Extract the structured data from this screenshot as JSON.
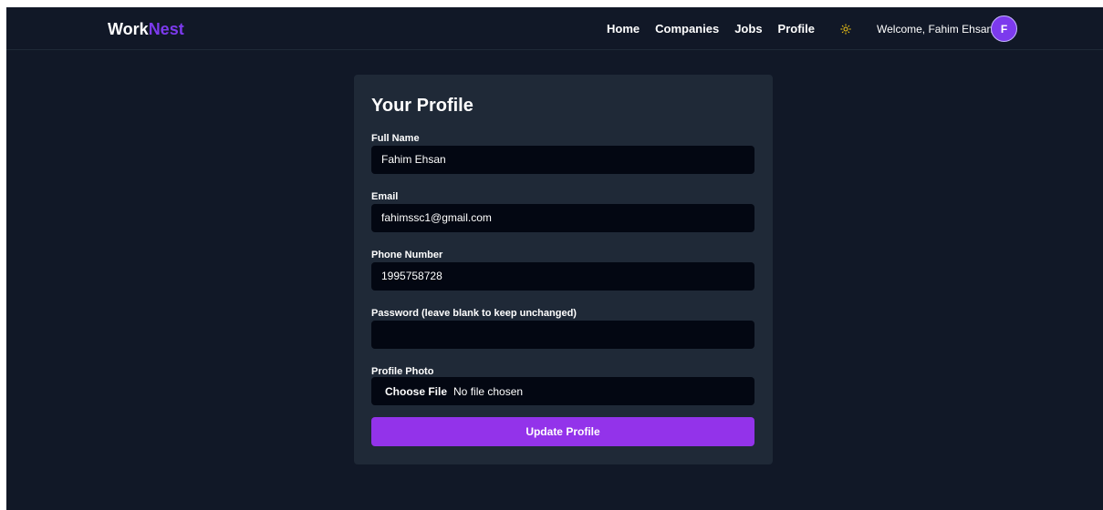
{
  "navbar": {
    "logo_part1": "Work",
    "logo_part2": "Nest",
    "links": [
      "Home",
      "Companies",
      "Jobs",
      "Profile"
    ],
    "theme_icon": "sun-icon",
    "welcome_text": "Welcome, Fahim Ehsan",
    "avatar_initial": "F"
  },
  "profile_form": {
    "title": "Your Profile",
    "full_name_label": "Full Name",
    "full_name_value": "Fahim Ehsan",
    "email_label": "Email",
    "email_value": "fahimssc1@gmail.com",
    "phone_label": "Phone Number",
    "phone_value": "1995758728",
    "password_label": "Password (leave blank to keep unchanged)",
    "password_value": "",
    "photo_label": "Profile Photo",
    "file_button_label": "Choose File",
    "file_status": "No file chosen",
    "submit_label": "Update Profile"
  },
  "colors": {
    "background": "#111827",
    "card": "#1f2937",
    "input": "#030712",
    "accent": "#9333ea",
    "logo_accent": "#7c3aed",
    "sun": "#facc15"
  }
}
